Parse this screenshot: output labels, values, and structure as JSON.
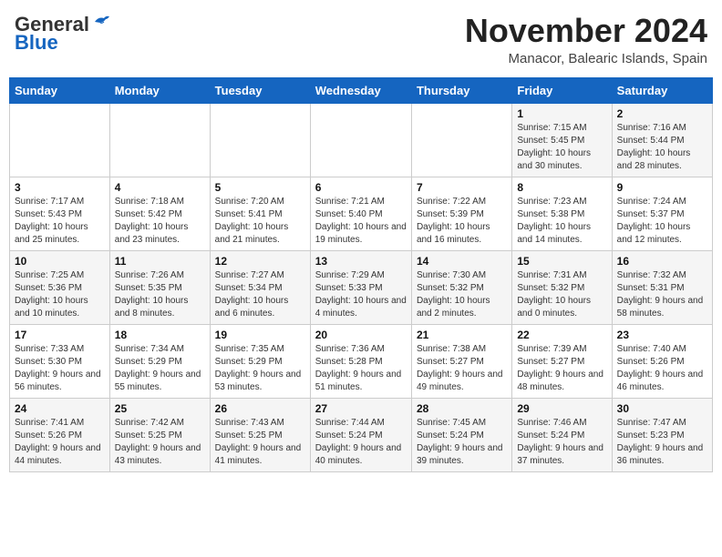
{
  "header": {
    "logo_general": "General",
    "logo_blue": "Blue",
    "month_title": "November 2024",
    "location": "Manacor, Balearic Islands, Spain"
  },
  "weekdays": [
    "Sunday",
    "Monday",
    "Tuesday",
    "Wednesday",
    "Thursday",
    "Friday",
    "Saturday"
  ],
  "weeks": [
    [
      {
        "day": "",
        "info": ""
      },
      {
        "day": "",
        "info": ""
      },
      {
        "day": "",
        "info": ""
      },
      {
        "day": "",
        "info": ""
      },
      {
        "day": "",
        "info": ""
      },
      {
        "day": "1",
        "info": "Sunrise: 7:15 AM\nSunset: 5:45 PM\nDaylight: 10 hours and 30 minutes."
      },
      {
        "day": "2",
        "info": "Sunrise: 7:16 AM\nSunset: 5:44 PM\nDaylight: 10 hours and 28 minutes."
      }
    ],
    [
      {
        "day": "3",
        "info": "Sunrise: 7:17 AM\nSunset: 5:43 PM\nDaylight: 10 hours and 25 minutes."
      },
      {
        "day": "4",
        "info": "Sunrise: 7:18 AM\nSunset: 5:42 PM\nDaylight: 10 hours and 23 minutes."
      },
      {
        "day": "5",
        "info": "Sunrise: 7:20 AM\nSunset: 5:41 PM\nDaylight: 10 hours and 21 minutes."
      },
      {
        "day": "6",
        "info": "Sunrise: 7:21 AM\nSunset: 5:40 PM\nDaylight: 10 hours and 19 minutes."
      },
      {
        "day": "7",
        "info": "Sunrise: 7:22 AM\nSunset: 5:39 PM\nDaylight: 10 hours and 16 minutes."
      },
      {
        "day": "8",
        "info": "Sunrise: 7:23 AM\nSunset: 5:38 PM\nDaylight: 10 hours and 14 minutes."
      },
      {
        "day": "9",
        "info": "Sunrise: 7:24 AM\nSunset: 5:37 PM\nDaylight: 10 hours and 12 minutes."
      }
    ],
    [
      {
        "day": "10",
        "info": "Sunrise: 7:25 AM\nSunset: 5:36 PM\nDaylight: 10 hours and 10 minutes."
      },
      {
        "day": "11",
        "info": "Sunrise: 7:26 AM\nSunset: 5:35 PM\nDaylight: 10 hours and 8 minutes."
      },
      {
        "day": "12",
        "info": "Sunrise: 7:27 AM\nSunset: 5:34 PM\nDaylight: 10 hours and 6 minutes."
      },
      {
        "day": "13",
        "info": "Sunrise: 7:29 AM\nSunset: 5:33 PM\nDaylight: 10 hours and 4 minutes."
      },
      {
        "day": "14",
        "info": "Sunrise: 7:30 AM\nSunset: 5:32 PM\nDaylight: 10 hours and 2 minutes."
      },
      {
        "day": "15",
        "info": "Sunrise: 7:31 AM\nSunset: 5:32 PM\nDaylight: 10 hours and 0 minutes."
      },
      {
        "day": "16",
        "info": "Sunrise: 7:32 AM\nSunset: 5:31 PM\nDaylight: 9 hours and 58 minutes."
      }
    ],
    [
      {
        "day": "17",
        "info": "Sunrise: 7:33 AM\nSunset: 5:30 PM\nDaylight: 9 hours and 56 minutes."
      },
      {
        "day": "18",
        "info": "Sunrise: 7:34 AM\nSunset: 5:29 PM\nDaylight: 9 hours and 55 minutes."
      },
      {
        "day": "19",
        "info": "Sunrise: 7:35 AM\nSunset: 5:29 PM\nDaylight: 9 hours and 53 minutes."
      },
      {
        "day": "20",
        "info": "Sunrise: 7:36 AM\nSunset: 5:28 PM\nDaylight: 9 hours and 51 minutes."
      },
      {
        "day": "21",
        "info": "Sunrise: 7:38 AM\nSunset: 5:27 PM\nDaylight: 9 hours and 49 minutes."
      },
      {
        "day": "22",
        "info": "Sunrise: 7:39 AM\nSunset: 5:27 PM\nDaylight: 9 hours and 48 minutes."
      },
      {
        "day": "23",
        "info": "Sunrise: 7:40 AM\nSunset: 5:26 PM\nDaylight: 9 hours and 46 minutes."
      }
    ],
    [
      {
        "day": "24",
        "info": "Sunrise: 7:41 AM\nSunset: 5:26 PM\nDaylight: 9 hours and 44 minutes."
      },
      {
        "day": "25",
        "info": "Sunrise: 7:42 AM\nSunset: 5:25 PM\nDaylight: 9 hours and 43 minutes."
      },
      {
        "day": "26",
        "info": "Sunrise: 7:43 AM\nSunset: 5:25 PM\nDaylight: 9 hours and 41 minutes."
      },
      {
        "day": "27",
        "info": "Sunrise: 7:44 AM\nSunset: 5:24 PM\nDaylight: 9 hours and 40 minutes."
      },
      {
        "day": "28",
        "info": "Sunrise: 7:45 AM\nSunset: 5:24 PM\nDaylight: 9 hours and 39 minutes."
      },
      {
        "day": "29",
        "info": "Sunrise: 7:46 AM\nSunset: 5:24 PM\nDaylight: 9 hours and 37 minutes."
      },
      {
        "day": "30",
        "info": "Sunrise: 7:47 AM\nSunset: 5:23 PM\nDaylight: 9 hours and 36 minutes."
      }
    ]
  ]
}
